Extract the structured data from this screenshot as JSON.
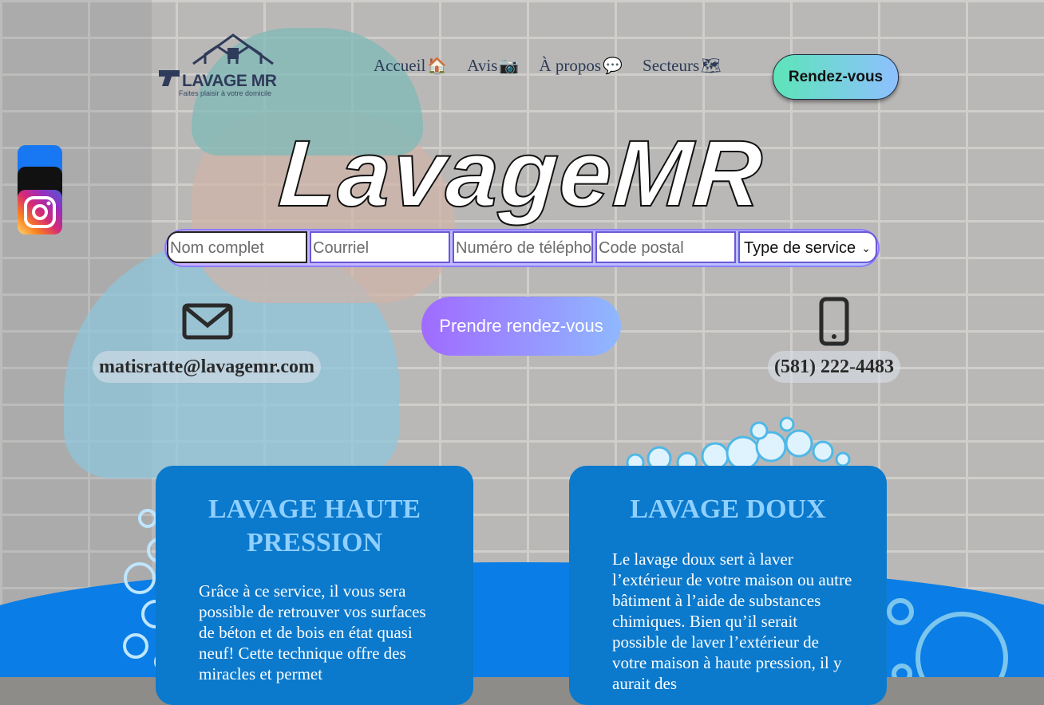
{
  "brand": {
    "name": "LAVAGE MR",
    "tagline": "Faites plaisir à votre domicile",
    "hero_title": "LavageMR"
  },
  "nav": {
    "items": [
      {
        "label": "Accueil",
        "icon": "house-icon",
        "glyph": "🏠"
      },
      {
        "label": "Avis",
        "icon": "camera-icon",
        "glyph": "📷"
      },
      {
        "label": "À propos",
        "icon": "speech-bubble-icon",
        "glyph": "💬"
      },
      {
        "label": "Secteurs",
        "icon": "map-icon",
        "glyph": "🗺"
      }
    ],
    "cta_label": "Rendez-vous"
  },
  "social": [
    "facebook-icon",
    "tiktok-icon",
    "instagram-icon"
  ],
  "form": {
    "name_placeholder": "Nom complet",
    "email_placeholder": "Courriel",
    "phone_placeholder": "Numéro de téléphone",
    "postal_placeholder": "Code postal",
    "service_select": "Type de service",
    "submit_label": "Prendre rendez-vous"
  },
  "contact": {
    "email": "matisratte@lavagemr.com",
    "phone": "(581) 222-4483"
  },
  "services": [
    {
      "title": "LAVAGE HAUTE PRESSION",
      "text": "Grâce à ce service, il vous sera possible de retrouver vos surfaces de béton et de bois en état quasi neuf! Cette technique offre des miracles et permet"
    },
    {
      "title": "LAVAGE DOUX",
      "text": "Le lavage doux sert à laver l’extérieur de votre maison ou autre bâtiment à l’aide de substances chimiques. Bien qu’il serait possible de laver l’extérieur de votre maison à haute pression, il y aurait des"
    }
  ],
  "colors": {
    "accent_blue": "#0b79cc",
    "cta_gradient_start": "#5de5b8",
    "cta_gradient_end": "#8ec0ff",
    "form_accent": "#8c7bff",
    "water": "#0a7ee6"
  }
}
